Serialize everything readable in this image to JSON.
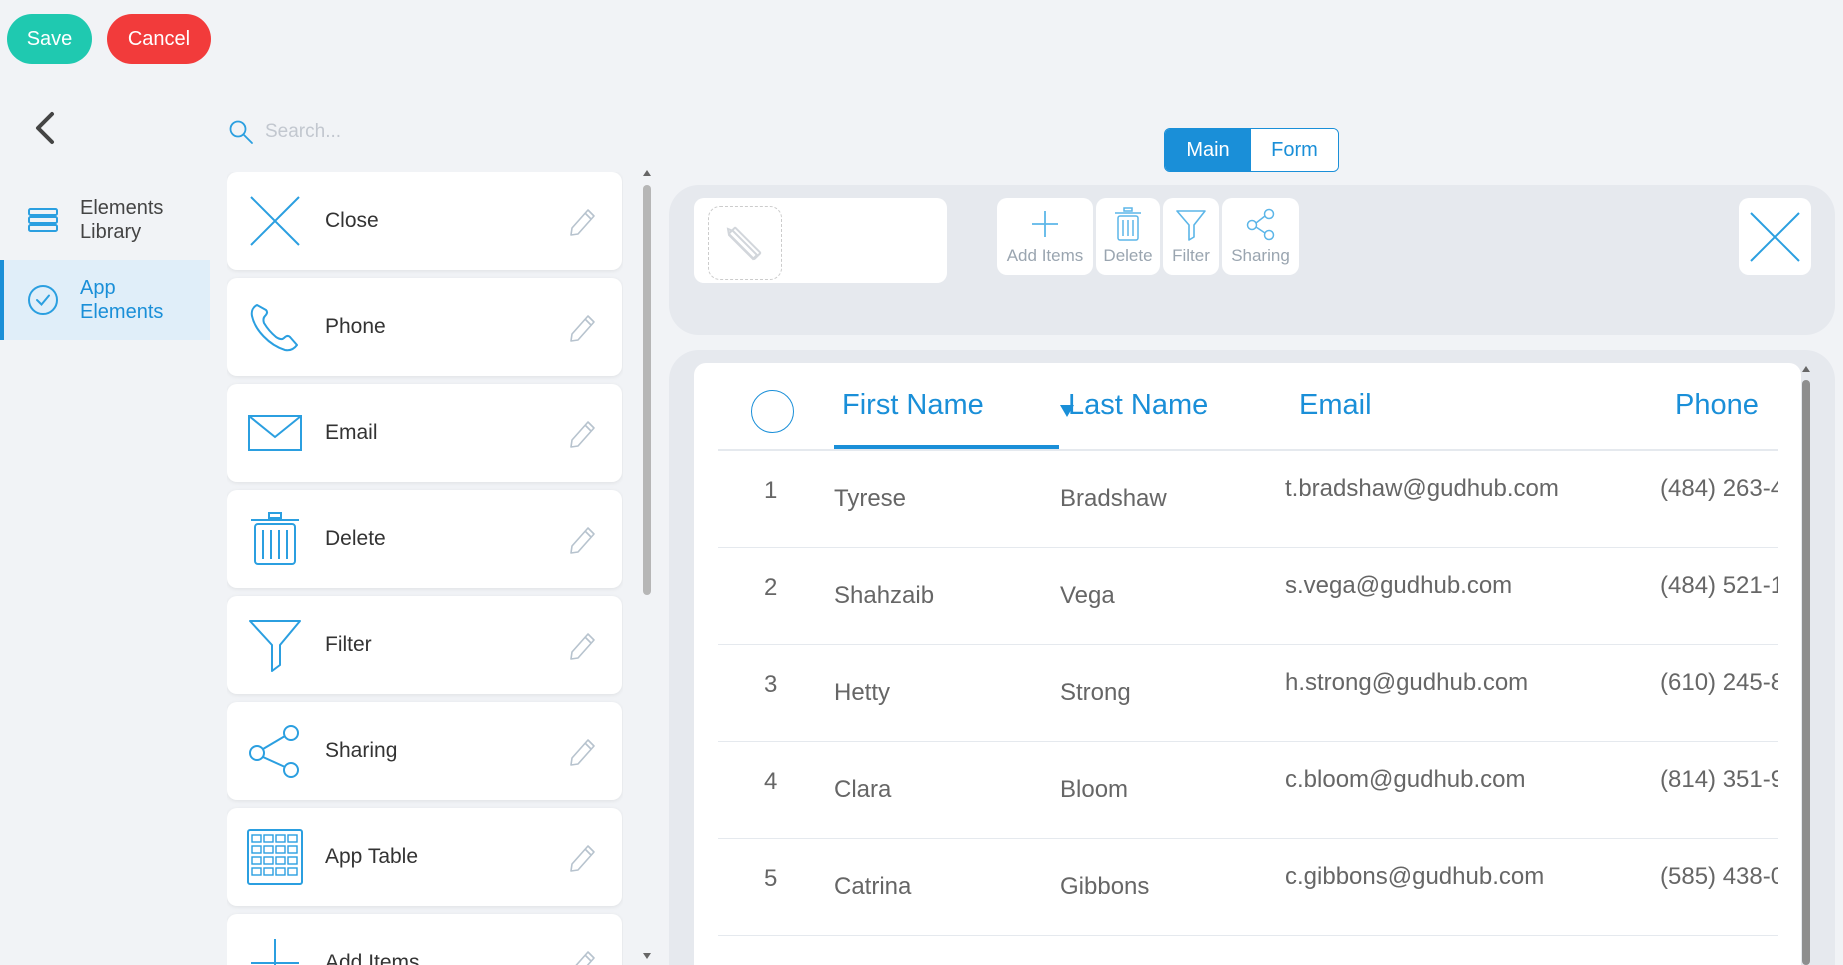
{
  "toolbar": {
    "save_label": "Save",
    "cancel_label": "Cancel"
  },
  "nav": {
    "items": [
      {
        "label": "Elements Library",
        "icon": "layers-icon",
        "active": false
      },
      {
        "label": "App Elements",
        "icon": "check-circle-icon",
        "active": true
      }
    ]
  },
  "search": {
    "placeholder": "Search..."
  },
  "elements": [
    {
      "label": "Close",
      "icon": "close-icon"
    },
    {
      "label": "Phone",
      "icon": "phone-icon"
    },
    {
      "label": "Email",
      "icon": "envelope-icon"
    },
    {
      "label": "Delete",
      "icon": "trash-icon"
    },
    {
      "label": "Filter",
      "icon": "funnel-icon"
    },
    {
      "label": "Sharing",
      "icon": "share-icon"
    },
    {
      "label": "App Table",
      "icon": "table-grid-icon"
    },
    {
      "label": "Add Items",
      "icon": "plus-icon"
    }
  ],
  "view_tabs": [
    {
      "label": "Main",
      "active": true
    },
    {
      "label": "Form",
      "active": false
    }
  ],
  "tools": [
    {
      "label": "Add Items",
      "icon": "plus-icon"
    },
    {
      "label": "Delete",
      "icon": "trash-icon"
    },
    {
      "label": "Filter",
      "icon": "funnel-icon"
    },
    {
      "label": "Sharing",
      "icon": "share-icon"
    }
  ],
  "table": {
    "columns": [
      "First Name",
      "Last Name",
      "Email",
      "Phone"
    ],
    "sorted_column": "First Name",
    "rows": [
      {
        "index": "1",
        "first": "Tyrese",
        "last": "Bradshaw",
        "email": "t.bradshaw@gudhub.com",
        "phone": "(484) 263-4"
      },
      {
        "index": "2",
        "first": "Shahzaib",
        "last": "Vega",
        "email": "s.vega@gudhub.com",
        "phone": "(484) 521-1"
      },
      {
        "index": "3",
        "first": "Hetty",
        "last": "Strong",
        "email": "h.strong@gudhub.com",
        "phone": "(610) 245-8"
      },
      {
        "index": "4",
        "first": "Clara",
        "last": "Bloom",
        "email": "c.bloom@gudhub.com",
        "phone": "(814) 351-9"
      },
      {
        "index": "5",
        "first": "Catrina",
        "last": "Gibbons",
        "email": "c.gibbons@gudhub.com",
        "phone": "(585) 438-0"
      }
    ]
  },
  "colors": {
    "accent": "#1a8fd8",
    "save": "#1fc9b0",
    "cancel": "#f23b3b",
    "icon_stroke": "#2b9fe0"
  }
}
